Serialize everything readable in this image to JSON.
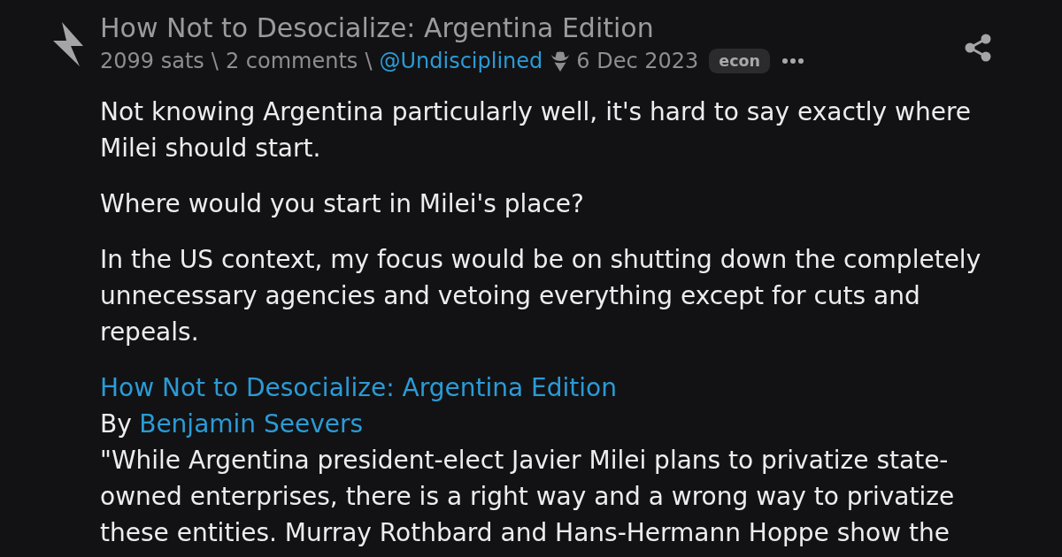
{
  "item": {
    "title": "How Not to Desocialize: Argentina Edition",
    "meta": [
      {
        "kind": "text",
        "text": "2099 sats"
      },
      {
        "kind": "separator",
        "text": "\\"
      },
      {
        "kind": "link",
        "text": "2 comments"
      },
      {
        "kind": "separator",
        "text": "\\"
      },
      {
        "kind": "user",
        "text": "@Undisciplined"
      },
      {
        "kind": "date",
        "text": "6 Dec 2023"
      },
      {
        "kind": "tag",
        "text": "econ"
      }
    ],
    "body": [
      {
        "kind": "paragraph",
        "text": "Not knowing Argentina particularly well, it's hard to say exactly where Milei should start."
      },
      {
        "kind": "paragraph",
        "text": "Where would you start in Milei's place?"
      },
      {
        "kind": "paragraph",
        "text": "In the US context, my focus would be on shutting down the completely unnecessary agencies and vetoing everything except for cuts and repeals."
      },
      {
        "kind": "embed",
        "title": "How Not to Desocialize: Argentina Edition",
        "byline": "By",
        "author": "Benjamin Seevers",
        "excerpt": "\"While Argentina president-elect Javier Milei plans to privatize state-owned enterprises, there is a right way and a wrong way to privatize these entities. Murray Rothbard and Hans-Hermann Hoppe show the"
      }
    ]
  }
}
